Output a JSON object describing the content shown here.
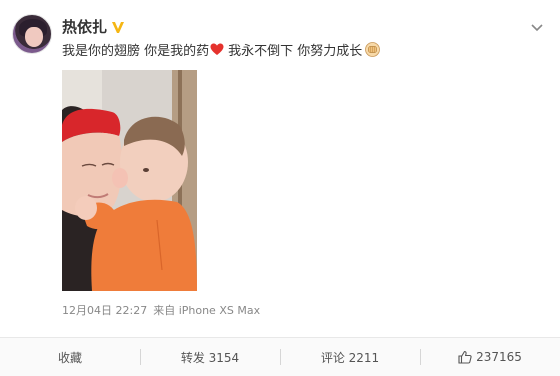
{
  "post": {
    "author": "热依扎",
    "text_part1": "我是你的翅膀 你是我的药",
    "text_part2": "我永不倒下 你努力成长",
    "emoji_heart": "heart-icon",
    "emoji_fist": "fist-icon",
    "time": "12月04日 22:27",
    "source": "来自 iPhone XS Max"
  },
  "actions": {
    "favorite_label": "收藏",
    "repost_label": "转发 3154",
    "comment_label": "评论 2211",
    "like_count": "237165"
  },
  "colors": {
    "verified_badge": "#f5b614",
    "heart": "#e5322d",
    "meta_text": "#888888"
  }
}
